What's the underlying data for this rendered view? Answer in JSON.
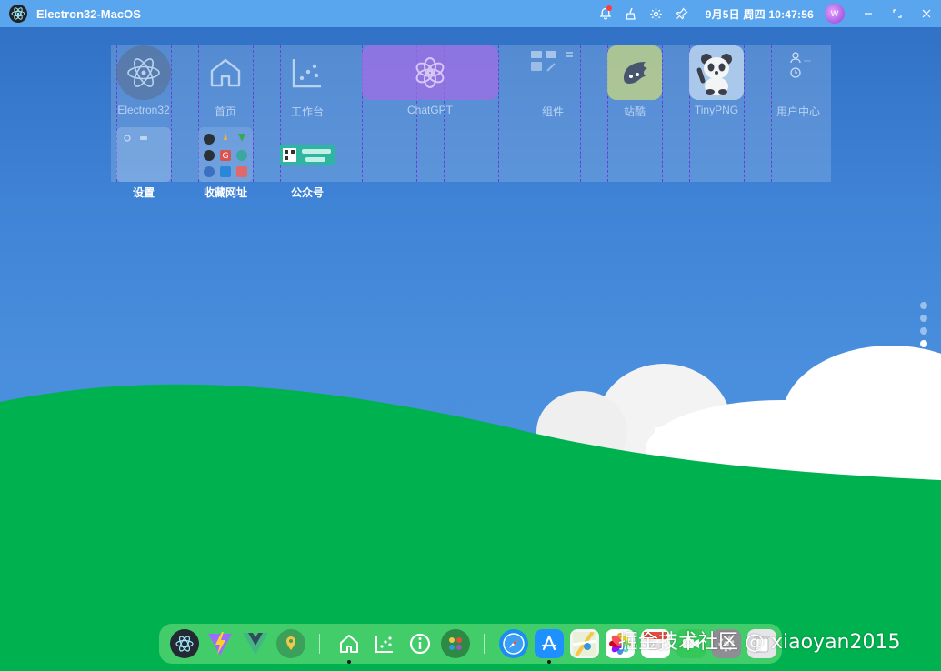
{
  "app": {
    "title": "Electron32-MacOS"
  },
  "topbar": {
    "datetime": "9月5日 周四 10:47:56",
    "icons": [
      "bell-icon",
      "broom-icon",
      "gear-icon",
      "pin-icon"
    ],
    "avatar_initials": "W"
  },
  "grid": {
    "items": [
      {
        "label": "Electron32",
        "icon": "electron-icon"
      },
      {
        "label": "首页",
        "icon": "home-icon"
      },
      {
        "label": "工作台",
        "icon": "chart-icon"
      },
      {
        "label": "ChatGPT",
        "icon": "chatgpt-icon"
      },
      {
        "label": "组件",
        "icon": "components-widget"
      },
      {
        "label": "站酷",
        "icon": "zcool-icon"
      },
      {
        "label": "TinyPNG",
        "icon": "panda-icon"
      },
      {
        "label": "用户中心",
        "icon": "user-center-widget"
      }
    ],
    "row2": [
      {
        "label": "设置"
      },
      {
        "label": "收藏网址"
      },
      {
        "label": "公众号"
      }
    ]
  },
  "pager": {
    "count": 4,
    "active_index": 3
  },
  "dock": {
    "items": [
      "electron-icon",
      "vite-icon",
      "vue-icon",
      "map-pin-icon",
      "home-icon",
      "chart-icon",
      "info-icon",
      "apps-icon",
      "safari-icon",
      "appstore-icon",
      "maps-icon",
      "photos-icon",
      "calendar-icon",
      "facetime-icon",
      "settings-icon",
      "trash-icon"
    ]
  },
  "watermark": "掘金技术社区 @ xiaoyan2015",
  "colors": {
    "topbar": "#5aa6ee",
    "grass": "#00b14f",
    "sky": "#3f83d6"
  }
}
